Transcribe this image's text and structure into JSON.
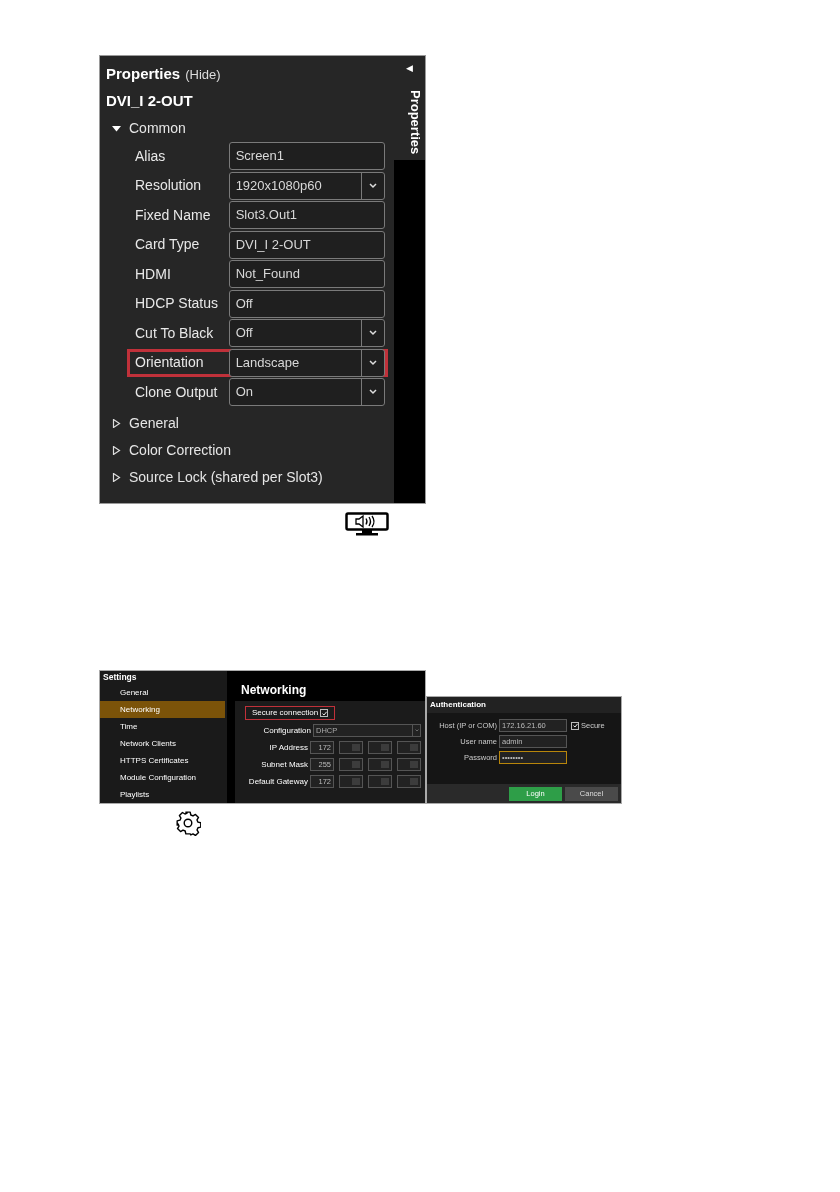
{
  "properties_panel": {
    "title": "Properties",
    "hide_link": "(Hide)",
    "collapse_arrow": "◀",
    "side_tab": "Properties",
    "device": "DVI_I 2-OUT",
    "sections": [
      {
        "label": "Common",
        "expanded": true,
        "fields": [
          {
            "label": "Alias",
            "value": "Screen1",
            "kind": "text",
            "highlighted": false
          },
          {
            "label": "Resolution",
            "value": "1920x1080p60",
            "kind": "dropdown",
            "highlighted": false
          },
          {
            "label": "Fixed Name",
            "value": "Slot3.Out1",
            "kind": "text",
            "highlighted": false
          },
          {
            "label": "Card Type",
            "value": "DVI_I 2-OUT",
            "kind": "text",
            "highlighted": false
          },
          {
            "label": "HDMI",
            "value": "Not_Found",
            "kind": "text",
            "highlighted": false
          },
          {
            "label": "HDCP Status",
            "value": "Off",
            "kind": "text",
            "highlighted": false
          },
          {
            "label": "Cut To Black",
            "value": "Off",
            "kind": "dropdown",
            "highlighted": false
          },
          {
            "label": "Orientation",
            "value": "Landscape",
            "kind": "dropdown",
            "highlighted": true
          },
          {
            "label": "Clone Output",
            "value": "On",
            "kind": "dropdown",
            "highlighted": false
          }
        ]
      },
      {
        "label": "General",
        "expanded": false
      },
      {
        "label": "Color Correction",
        "expanded": false
      },
      {
        "label": "Source Lock (shared per Slot3)",
        "expanded": false
      }
    ]
  },
  "settings": {
    "title": "Settings",
    "nav": [
      {
        "label": "General",
        "selected": false
      },
      {
        "label": "Networking",
        "selected": true
      },
      {
        "label": "Time",
        "selected": false
      },
      {
        "label": "Network Clients",
        "selected": false
      },
      {
        "label": "HTTPS Certificates",
        "selected": false
      },
      {
        "label": "Module Configuration",
        "selected": false
      },
      {
        "label": "Playlists",
        "selected": false
      }
    ],
    "heading": "Networking",
    "secure_connection": {
      "label": "Secure connection",
      "checked": true,
      "highlighted": true
    },
    "configuration": {
      "label": "Configuration",
      "value": "DHCP"
    },
    "addresses": [
      {
        "label": "IP Address",
        "octets": [
          {
            "kind": "value",
            "value": "172"
          },
          {
            "kind": "blurred"
          },
          {
            "kind": "blurred"
          },
          {
            "kind": "blurred"
          }
        ]
      },
      {
        "label": "Subnet Mask",
        "octets": [
          {
            "kind": "value",
            "value": "255"
          },
          {
            "kind": "blurred"
          },
          {
            "kind": "blurred"
          },
          {
            "kind": "blurred"
          }
        ]
      },
      {
        "label": "Default Gateway",
        "octets": [
          {
            "kind": "value",
            "value": "172"
          },
          {
            "kind": "blurred"
          },
          {
            "kind": "blurred"
          },
          {
            "kind": "blurred"
          }
        ]
      }
    ]
  },
  "authentication": {
    "title": "Authentication",
    "host": {
      "label": "Host (IP or COM)",
      "value": "172.16.21.60"
    },
    "secure": {
      "label": "Secure",
      "checked": true
    },
    "username": {
      "label": "User name",
      "value": "admin"
    },
    "password": {
      "label": "Password",
      "value": "••••••••",
      "focused": true
    },
    "buttons": [
      {
        "label": "Login",
        "kind": "primary"
      },
      {
        "label": "Cancel",
        "kind": "secondary"
      }
    ]
  }
}
